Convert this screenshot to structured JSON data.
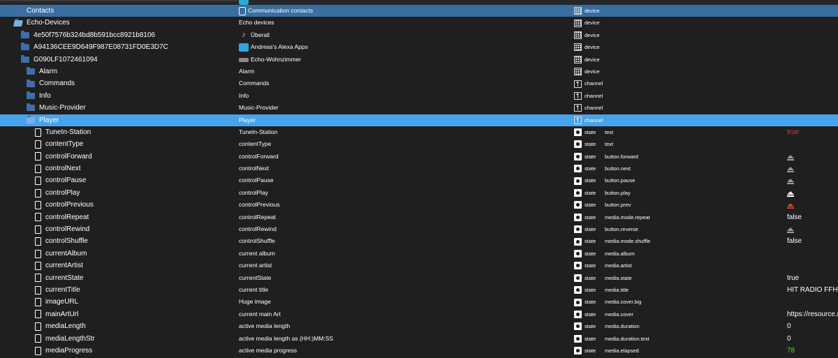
{
  "colors": {
    "red": "#e03a2a",
    "green": "#4cdc2a",
    "white": "#ffffff",
    "grey": "#bbbbbb"
  },
  "rows": [
    {
      "indent": 20,
      "icon": "folder-icon",
      "name": "Contacts",
      "desc": "Communication contacts",
      "descIcon": "contacts-icon",
      "type": "device",
      "typeIcon": "device",
      "sel": "dark"
    },
    {
      "indent": 20,
      "icon": "folder-open-icon",
      "name": "Echo-Devices",
      "desc": "Echo devices",
      "type": "device",
      "typeIcon": "device"
    },
    {
      "indent": 30,
      "icon": "folder-icon",
      "name": "4e50f7576b324bd8b591bcc8921b8106",
      "desc": "Überall",
      "descIcon": "music-note-icon",
      "type": "device",
      "typeIcon": "device"
    },
    {
      "indent": 30,
      "icon": "folder-icon",
      "name": "A94136CEE9D649F987E08731FD0E3D7C",
      "desc": "Andreas's Alexa Apps",
      "descIcon": "alexa-app-icon",
      "type": "device",
      "typeIcon": "device"
    },
    {
      "indent": 30,
      "icon": "folder-icon",
      "name": "G090LF1072461094",
      "desc": "Echo-Wohnzimmer",
      "descIcon": "echo-device-icon",
      "type": "device",
      "typeIcon": "device"
    },
    {
      "indent": 38,
      "icon": "folder-icon",
      "name": "Alarm",
      "desc": "Alarm",
      "type": "device",
      "typeIcon": "device"
    },
    {
      "indent": 38,
      "icon": "folder-icon",
      "name": "Commands",
      "desc": "Commands",
      "type": "channel",
      "typeIcon": "channel"
    },
    {
      "indent": 38,
      "icon": "folder-icon",
      "name": "Info",
      "desc": "Info",
      "type": "channel",
      "typeIcon": "channel"
    },
    {
      "indent": 38,
      "icon": "folder-icon",
      "name": "Music-Provider",
      "desc": "Music-Provider",
      "type": "channel",
      "typeIcon": "channel"
    },
    {
      "indent": 38,
      "icon": "folder-open-icon",
      "name": "Player",
      "desc": "Player",
      "type": "channel",
      "typeIcon": "channel",
      "sel": "light"
    },
    {
      "indent": 50,
      "icon": "file-icon",
      "name": "TuneIn-Station",
      "desc": "TuneIn-Station",
      "type": "state",
      "typeIcon": "state",
      "role": "text",
      "value": "true",
      "valueColor": "#e03a2a"
    },
    {
      "indent": 50,
      "icon": "file-icon",
      "name": "contentType",
      "desc": "contentType",
      "type": "state",
      "typeIcon": "state",
      "role": "text"
    },
    {
      "indent": 50,
      "icon": "file-icon",
      "name": "controlForward",
      "desc": "controlForward",
      "type": "state",
      "typeIcon": "state",
      "role": "button.forward",
      "valueIcon": "eject-icon",
      "valueColor": "#999999"
    },
    {
      "indent": 50,
      "icon": "file-icon",
      "name": "controlNext",
      "desc": "controlNext",
      "type": "state",
      "typeIcon": "state",
      "role": "button.next",
      "valueIcon": "eject-icon",
      "valueColor": "#999999"
    },
    {
      "indent": 50,
      "icon": "file-icon",
      "name": "controlPause",
      "desc": "controlPause",
      "type": "state",
      "typeIcon": "state",
      "role": "button.pause",
      "valueIcon": "eject-icon",
      "valueColor": "#999999"
    },
    {
      "indent": 50,
      "icon": "file-icon",
      "name": "controlPlay",
      "desc": "controlPlay",
      "type": "state",
      "typeIcon": "state",
      "role": "button.play",
      "valueIcon": "eject-icon",
      "valueColor": "#ffffff"
    },
    {
      "indent": 50,
      "icon": "file-icon",
      "name": "controlPrevious",
      "desc": "controlPrevious",
      "type": "state",
      "typeIcon": "state",
      "role": "button.prev",
      "valueIcon": "eject-icon",
      "valueColor": "#e03a2a"
    },
    {
      "indent": 50,
      "icon": "file-icon",
      "name": "controlRepeat",
      "desc": "controlRepeat",
      "type": "state",
      "typeIcon": "state",
      "role": "media.mode.repeat",
      "value": "false",
      "valueColor": "#ffffff"
    },
    {
      "indent": 50,
      "icon": "file-icon",
      "name": "controlRewind",
      "desc": "controlRewind",
      "type": "state",
      "typeIcon": "state",
      "role": "button.reverse",
      "valueIcon": "eject-icon",
      "valueColor": "#999999"
    },
    {
      "indent": 50,
      "icon": "file-icon",
      "name": "controlShuffle",
      "desc": "controlShuffle",
      "type": "state",
      "typeIcon": "state",
      "role": "media.mode.shuffle",
      "value": "false",
      "valueColor": "#ffffff"
    },
    {
      "indent": 50,
      "icon": "file-icon",
      "name": "currentAlbum",
      "desc": "current album",
      "type": "state",
      "typeIcon": "state",
      "role": "media.album"
    },
    {
      "indent": 50,
      "icon": "file-icon",
      "name": "currentArtist",
      "desc": "current artist",
      "type": "state",
      "typeIcon": "state",
      "role": "media.artist"
    },
    {
      "indent": 50,
      "icon": "file-icon",
      "name": "currentState",
      "desc": "currentState",
      "type": "state",
      "typeIcon": "state",
      "role": "media.state",
      "value": "true",
      "valueColor": "#ffffff"
    },
    {
      "indent": 50,
      "icon": "file-icon",
      "name": "currentTitle",
      "desc": "current title",
      "type": "state",
      "typeIcon": "state",
      "role": "media.title",
      "value": "HIT RADIO FFH",
      "valueColor": "#ffffff"
    },
    {
      "indent": 50,
      "icon": "file-icon",
      "name": "imageURL",
      "desc": "Huge image",
      "type": "state",
      "typeIcon": "state",
      "role": "media.cover.big"
    },
    {
      "indent": 50,
      "icon": "file-icon",
      "name": "mainArtUrl",
      "desc": "current main Art",
      "type": "state",
      "typeIcon": "state",
      "role": "media.cover",
      "value": "https://resource.r...",
      "valueColor": "#ffffff"
    },
    {
      "indent": 50,
      "icon": "file-icon",
      "name": "mediaLength",
      "desc": "active media length",
      "type": "state",
      "typeIcon": "state",
      "role": "media.duration",
      "value": "0",
      "valueColor": "#ffffff"
    },
    {
      "indent": 50,
      "icon": "file-icon",
      "name": "mediaLengthStr",
      "desc": "active media length as (HH:)MM:SS",
      "type": "state",
      "typeIcon": "state",
      "role": "media.duration.text",
      "value": "0",
      "valueColor": "#ffffff"
    },
    {
      "indent": 50,
      "icon": "file-icon",
      "name": "mediaProgress",
      "desc": "active media progress",
      "type": "state",
      "typeIcon": "state",
      "role": "media.elapsed",
      "value": "78",
      "valueColor": "#4cdc2a"
    }
  ]
}
